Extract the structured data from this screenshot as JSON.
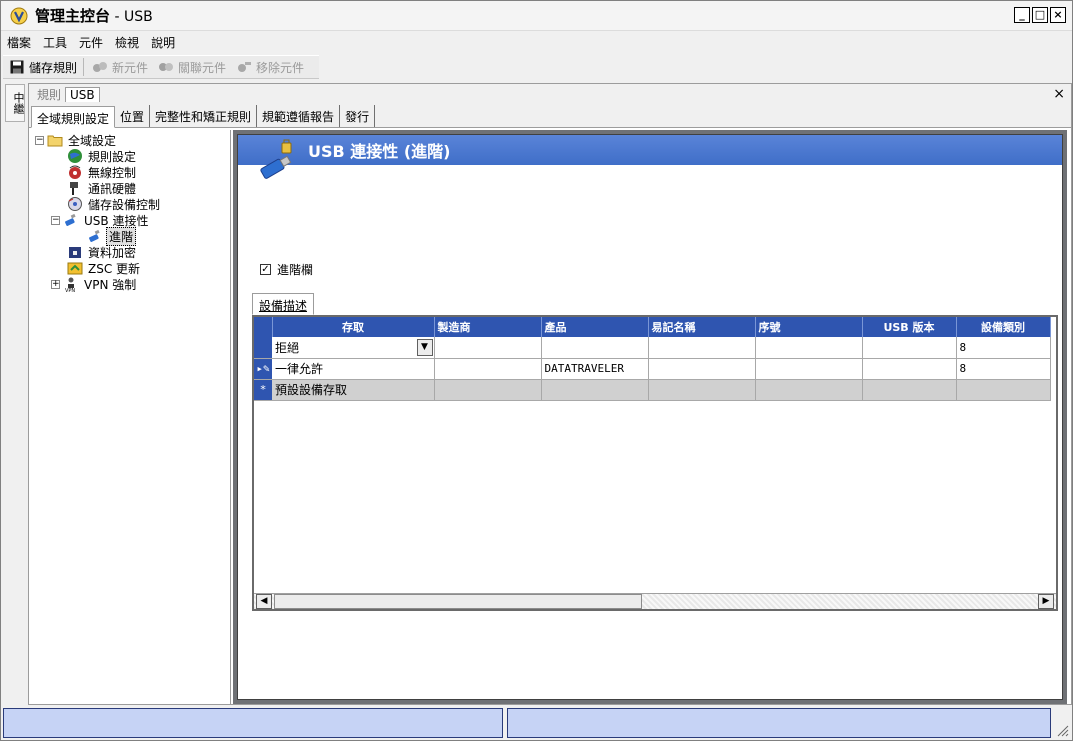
{
  "window": {
    "title": "管理主控台",
    "title_suffix": " - USB",
    "controls": [
      "_",
      "□",
      "×"
    ]
  },
  "menu": [
    "檔案",
    "工具",
    "元件",
    "檢視",
    "說明"
  ],
  "toolbar": {
    "save_label": "儲存規則",
    "new_label": "新元件",
    "link_label": "關聯元件",
    "remove_label": "移除元件"
  },
  "side_strip": {
    "label": "中繼"
  },
  "doc_tabs": {
    "rules": "規則",
    "usb": "USB",
    "close": "×"
  },
  "sub_tabs": [
    "全域規則設定",
    "位置",
    "完整性和矯正規則",
    "規範遵循報告",
    "發行"
  ],
  "tree": {
    "root": "全域設定",
    "items": [
      {
        "label": "規則設定",
        "icon": "globe-icon"
      },
      {
        "label": "無線控制",
        "icon": "wireless-icon"
      },
      {
        "label": "通訊硬體",
        "icon": "hardware-icon"
      },
      {
        "label": "儲存設備控制",
        "icon": "storage-icon"
      },
      {
        "label": "USB 連接性",
        "icon": "usb-icon"
      },
      {
        "label": "進階",
        "icon": "usb-advanced-icon"
      },
      {
        "label": "資料加密",
        "icon": "encryption-icon"
      },
      {
        "label": "ZSC 更新",
        "icon": "update-icon"
      },
      {
        "label": "VPN 強制",
        "icon": "vpn-icon"
      }
    ]
  },
  "panel": {
    "header": "USB 連接性 (進階)",
    "advanced_checkbox_label": "進階欄",
    "advanced_checked": true,
    "grid_tab": "設備描述"
  },
  "grid": {
    "columns": [
      "存取",
      "製造商",
      "產品",
      "易記名稱",
      "序號",
      "USB 版本",
      "設備類別"
    ],
    "rows": [
      {
        "marker": "",
        "access": "拒絕",
        "manufacturer": "",
        "product": "",
        "friendly": "",
        "serial": "",
        "usb_version": "",
        "device_class": "8"
      },
      {
        "marker": "▸✎",
        "access": "一律允許",
        "manufacturer": "",
        "product": "DATATRAVELER",
        "friendly": "",
        "serial": "",
        "usb_version": "",
        "device_class": "8"
      },
      {
        "marker": "*",
        "access": "預設設備存取",
        "manufacturer": "",
        "product": "",
        "friendly": "",
        "serial": "",
        "usb_version": "",
        "device_class": ""
      }
    ]
  },
  "colors": {
    "header_blue": "#3f6ec8",
    "grid_header": "#2f55b0",
    "status_blue": "#c6d3f5"
  }
}
